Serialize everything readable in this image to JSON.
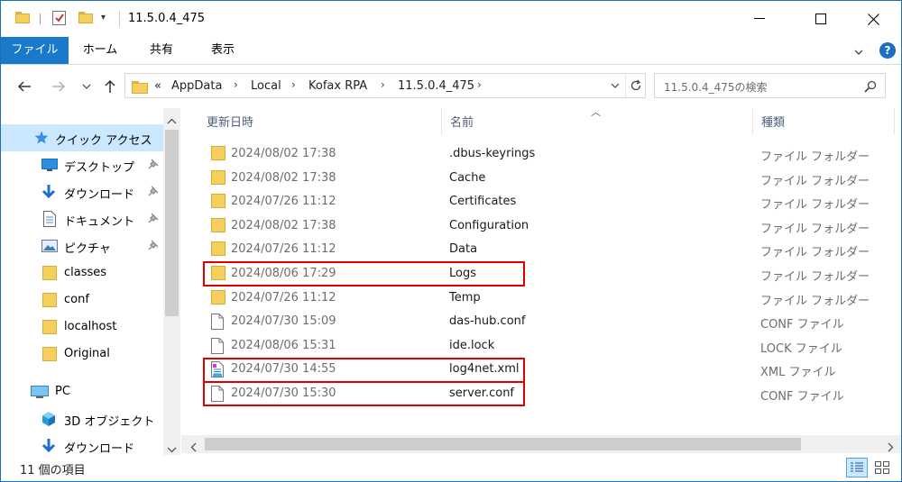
{
  "window": {
    "title": "11.5.0.4_475"
  },
  "ribbon": {
    "tabs": [
      "ファイル",
      "ホーム",
      "共有",
      "表示"
    ],
    "help": "?"
  },
  "address": {
    "prefix": "«",
    "crumbs": [
      "AppData",
      "Local",
      "Kofax RPA",
      "11.5.0.4_475"
    ]
  },
  "search": {
    "placeholder": "11.5.0.4_475の検索"
  },
  "nav": {
    "quick_access": "クイック アクセス",
    "pinned": [
      {
        "label": "デスクトップ",
        "icon": "desktop-icon"
      },
      {
        "label": "ダウンロード",
        "icon": "download-icon"
      },
      {
        "label": "ドキュメント",
        "icon": "document-icon"
      },
      {
        "label": "ピクチャ",
        "icon": "pictures-icon"
      }
    ],
    "folders": [
      "classes",
      "conf",
      "localhost",
      "Original"
    ],
    "pc": "PC",
    "pc_items": [
      {
        "label": "3D オブジェクト",
        "icon": "3d-objects-icon"
      },
      {
        "label": "ダウンロード",
        "icon": "download-icon"
      }
    ]
  },
  "columns": {
    "date": "更新日時",
    "name": "名前",
    "type": "種類"
  },
  "files": [
    {
      "date": "2024/08/02 17:38",
      "name": ".dbus-keyrings",
      "type": "ファイル フォルダー",
      "icon": "folder-icon",
      "highlighted": false
    },
    {
      "date": "2024/08/02 17:38",
      "name": "Cache",
      "type": "ファイル フォルダー",
      "icon": "folder-icon",
      "highlighted": false
    },
    {
      "date": "2024/07/26 11:12",
      "name": "Certificates",
      "type": "ファイル フォルダー",
      "icon": "folder-icon",
      "highlighted": false
    },
    {
      "date": "2024/08/02 17:38",
      "name": "Configuration",
      "type": "ファイル フォルダー",
      "icon": "folder-icon",
      "highlighted": false
    },
    {
      "date": "2024/07/26 11:12",
      "name": "Data",
      "type": "ファイル フォルダー",
      "icon": "folder-icon",
      "highlighted": false
    },
    {
      "date": "2024/08/06 17:29",
      "name": "Logs",
      "type": "ファイル フォルダー",
      "icon": "folder-icon",
      "highlighted": true
    },
    {
      "date": "2024/07/26 11:12",
      "name": "Temp",
      "type": "ファイル フォルダー",
      "icon": "folder-icon",
      "highlighted": false
    },
    {
      "date": "2024/07/30 15:09",
      "name": "das-hub.conf",
      "type": "CONF ファイル",
      "icon": "file-icon",
      "highlighted": false
    },
    {
      "date": "2024/08/06 15:31",
      "name": "ide.lock",
      "type": "LOCK ファイル",
      "icon": "file-icon",
      "highlighted": false
    },
    {
      "date": "2024/07/30 14:55",
      "name": "log4net.xml",
      "type": "XML ファイル",
      "icon": "xml-file-icon",
      "highlighted": true
    },
    {
      "date": "2024/07/30 15:30",
      "name": "server.conf",
      "type": "CONF ファイル",
      "icon": "file-icon",
      "highlighted": true
    }
  ],
  "status": {
    "count": "11 個の項目"
  },
  "colors": {
    "accent": "#1979ca",
    "highlight": "#e00000",
    "selection": "#cce8ff",
    "folder": "#f5cf5b"
  }
}
